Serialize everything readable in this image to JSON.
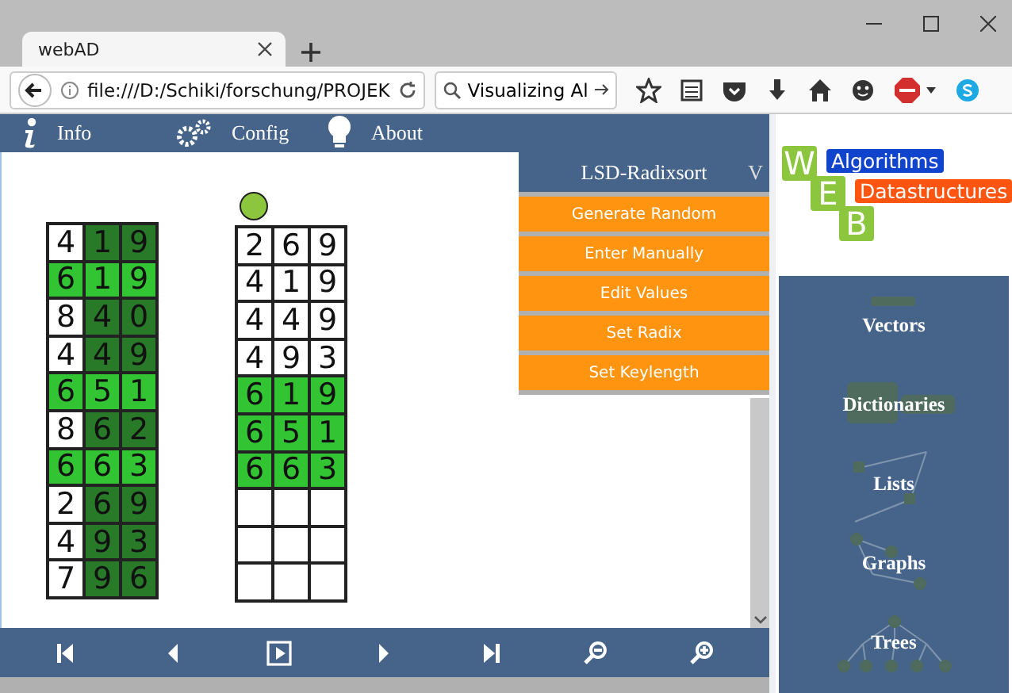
{
  "browser": {
    "tab": {
      "title": "webAD"
    },
    "address": "file:///D:/Schiki/forschung/PROJEK",
    "search": "Visualizing Al"
  },
  "nav": [
    "Info",
    "Config",
    "About"
  ],
  "tables": [
    {
      "rows": [
        {
          "cells": [
            {
              "text": "4",
              "kind": "plain"
            },
            {
              "text": "1",
              "kind": "dark"
            },
            {
              "text": "9",
              "kind": "dark"
            }
          ]
        },
        {
          "cells": [
            {
              "text": "6",
              "kind": "light"
            },
            {
              "text": "1",
              "kind": "light"
            },
            {
              "text": "9",
              "kind": "light"
            }
          ]
        },
        {
          "cells": [
            {
              "text": "8",
              "kind": "plain"
            },
            {
              "text": "4",
              "kind": "dark"
            },
            {
              "text": "0",
              "kind": "dark"
            }
          ]
        },
        {
          "cells": [
            {
              "text": "4",
              "kind": "plain"
            },
            {
              "text": "4",
              "kind": "dark"
            },
            {
              "text": "9",
              "kind": "dark"
            }
          ]
        },
        {
          "cells": [
            {
              "text": "6",
              "kind": "light"
            },
            {
              "text": "5",
              "kind": "light"
            },
            {
              "text": "1",
              "kind": "light"
            }
          ]
        },
        {
          "cells": [
            {
              "text": "8",
              "kind": "plain"
            },
            {
              "text": "6",
              "kind": "dark"
            },
            {
              "text": "2",
              "kind": "dark"
            }
          ]
        },
        {
          "cells": [
            {
              "text": "6",
              "kind": "light"
            },
            {
              "text": "6",
              "kind": "light"
            },
            {
              "text": "3",
              "kind": "light"
            }
          ]
        },
        {
          "cells": [
            {
              "text": "2",
              "kind": "plain"
            },
            {
              "text": "6",
              "kind": "dark"
            },
            {
              "text": "9",
              "kind": "dark"
            }
          ]
        },
        {
          "cells": [
            {
              "text": "4",
              "kind": "plain"
            },
            {
              "text": "9",
              "kind": "dark"
            },
            {
              "text": "3",
              "kind": "dark"
            }
          ]
        },
        {
          "cells": [
            {
              "text": "7",
              "kind": "plain"
            },
            {
              "text": "9",
              "kind": "dark"
            },
            {
              "text": "6",
              "kind": "dark"
            }
          ]
        }
      ]
    },
    {
      "marker": true,
      "rows": [
        {
          "cells": [
            {
              "text": "2",
              "kind": "plain"
            },
            {
              "text": "6",
              "kind": "plain"
            },
            {
              "text": "9",
              "kind": "plain"
            }
          ]
        },
        {
          "cells": [
            {
              "text": "4",
              "kind": "plain"
            },
            {
              "text": "1",
              "kind": "plain"
            },
            {
              "text": "9",
              "kind": "plain"
            }
          ]
        },
        {
          "cells": [
            {
              "text": "4",
              "kind": "plain"
            },
            {
              "text": "4",
              "kind": "plain"
            },
            {
              "text": "9",
              "kind": "plain"
            }
          ]
        },
        {
          "cells": [
            {
              "text": "4",
              "kind": "plain"
            },
            {
              "text": "9",
              "kind": "plain"
            },
            {
              "text": "3",
              "kind": "plain"
            }
          ]
        },
        {
          "cells": [
            {
              "text": "6",
              "kind": "light"
            },
            {
              "text": "1",
              "kind": "light"
            },
            {
              "text": "9",
              "kind": "light"
            }
          ]
        },
        {
          "cells": [
            {
              "text": "6",
              "kind": "light"
            },
            {
              "text": "5",
              "kind": "light"
            },
            {
              "text": "1",
              "kind": "light"
            }
          ]
        },
        {
          "cells": [
            {
              "text": "6",
              "kind": "light"
            },
            {
              "text": "6",
              "kind": "light"
            },
            {
              "text": "3",
              "kind": "light"
            }
          ]
        },
        {
          "cells": [
            {
              "kind": "plain"
            },
            {
              "kind": "plain"
            },
            {
              "kind": "plain"
            }
          ]
        },
        {
          "cells": [
            {
              "kind": "plain"
            },
            {
              "kind": "plain"
            },
            {
              "kind": "plain"
            }
          ]
        },
        {
          "cells": [
            {
              "kind": "plain"
            },
            {
              "kind": "plain"
            },
            {
              "kind": "plain"
            }
          ]
        }
      ]
    }
  ],
  "menu": {
    "title": "LSD-Radixsort",
    "toggle": "V",
    "items": [
      "Generate Random",
      "Enter Manually",
      "Edit Values",
      "Set Radix",
      "Set Keylength"
    ]
  },
  "logo": {
    "letters": [
      "W",
      "E",
      "B"
    ],
    "tags": [
      "Algorithms",
      "Datastructures"
    ]
  },
  "categories": [
    "Vectors",
    "Dictionaries",
    "Lists",
    "Graphs",
    "Trees"
  ]
}
